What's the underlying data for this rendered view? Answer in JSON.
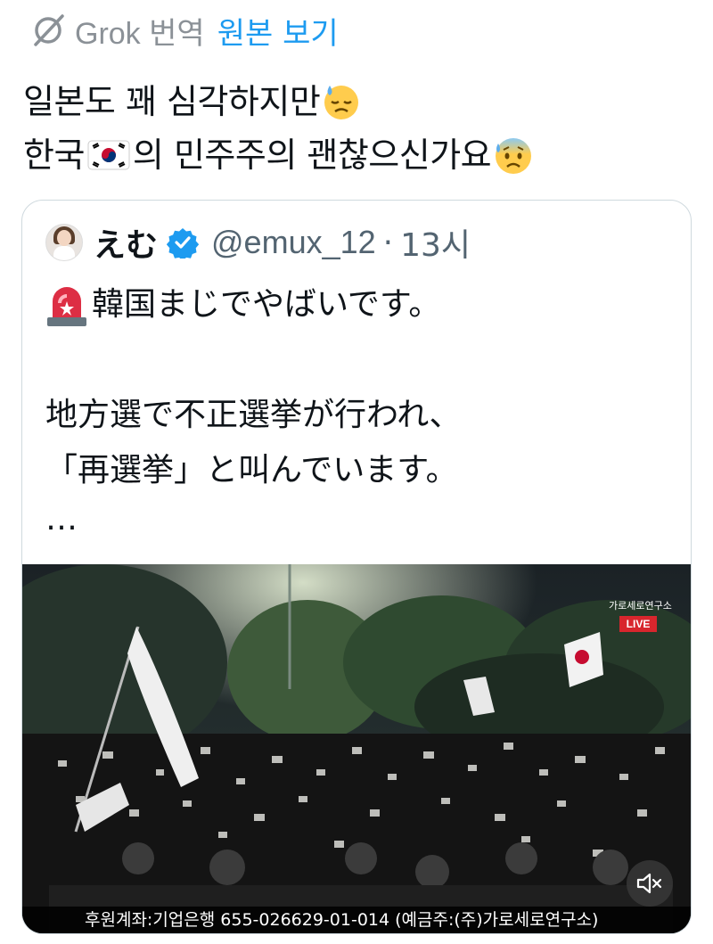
{
  "translation_bar": {
    "icon": "grok-icon",
    "provider": "Grok",
    "action": "번역",
    "show_original": "원본 보기"
  },
  "tweet": {
    "line1": "일본도 꽤 심각하지만",
    "line1_emoji": "downcast-face-with-sweat",
    "line2_a": "한국",
    "line2_flag": "south-korea-flag",
    "line2_b": "의 민주주의 괜찮으신가요",
    "line2_emoji": "anxious-face-with-sweat"
  },
  "quote": {
    "author_name": "えむ",
    "verified": true,
    "handle": "@emux_12",
    "separator": "·",
    "time": "13시",
    "siren_emoji": "police-car-light",
    "line1": "韓国まじでやばいです。",
    "line2": "地方選で不正選挙が行われ、",
    "line3": "「再選挙」と叫んでいます。",
    "ellipsis": "…",
    "video": {
      "station": "가로세로연구소",
      "live_label": "LIVE",
      "caption": "후원계좌:기업은행 655-026629-01-014 (예금주:(주)가로세로연구소)",
      "mute_icon": "speaker-muted-icon"
    }
  },
  "colors": {
    "accent": "#1d9bf0",
    "secondary_text": "#536471",
    "live_red": "#d8262d"
  }
}
